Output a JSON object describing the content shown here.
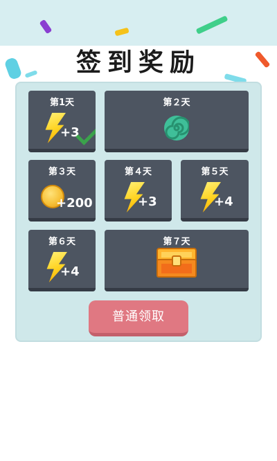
{
  "title": "签到奖励",
  "days": [
    {
      "label": "第1天",
      "amount": "+3"
    },
    {
      "label": "第２天"
    },
    {
      "label": "第３天",
      "amount": "+200"
    },
    {
      "label": "第４天",
      "amount": "+3"
    },
    {
      "label": "第５天",
      "amount": "+4"
    },
    {
      "label": "第６天",
      "amount": "+4"
    },
    {
      "label": "第７天"
    }
  ],
  "claim_button": "普通领取",
  "colors": {
    "top_band": "#d7eef1",
    "panel": "#cfe8ea",
    "card": "#4d5561",
    "button": "#e07882",
    "bolt": "#ffd21f",
    "check": "#3aa34b",
    "spiral": "#3fbf99"
  },
  "icons": {
    "day1": [
      "lightning-icon",
      "check-icon"
    ],
    "day2": "spiral-icon",
    "day3": "coin-icon",
    "day4": "lightning-icon",
    "day5": "lightning-icon",
    "day6": "lightning-icon",
    "day7": "treasure-chest-icon"
  }
}
